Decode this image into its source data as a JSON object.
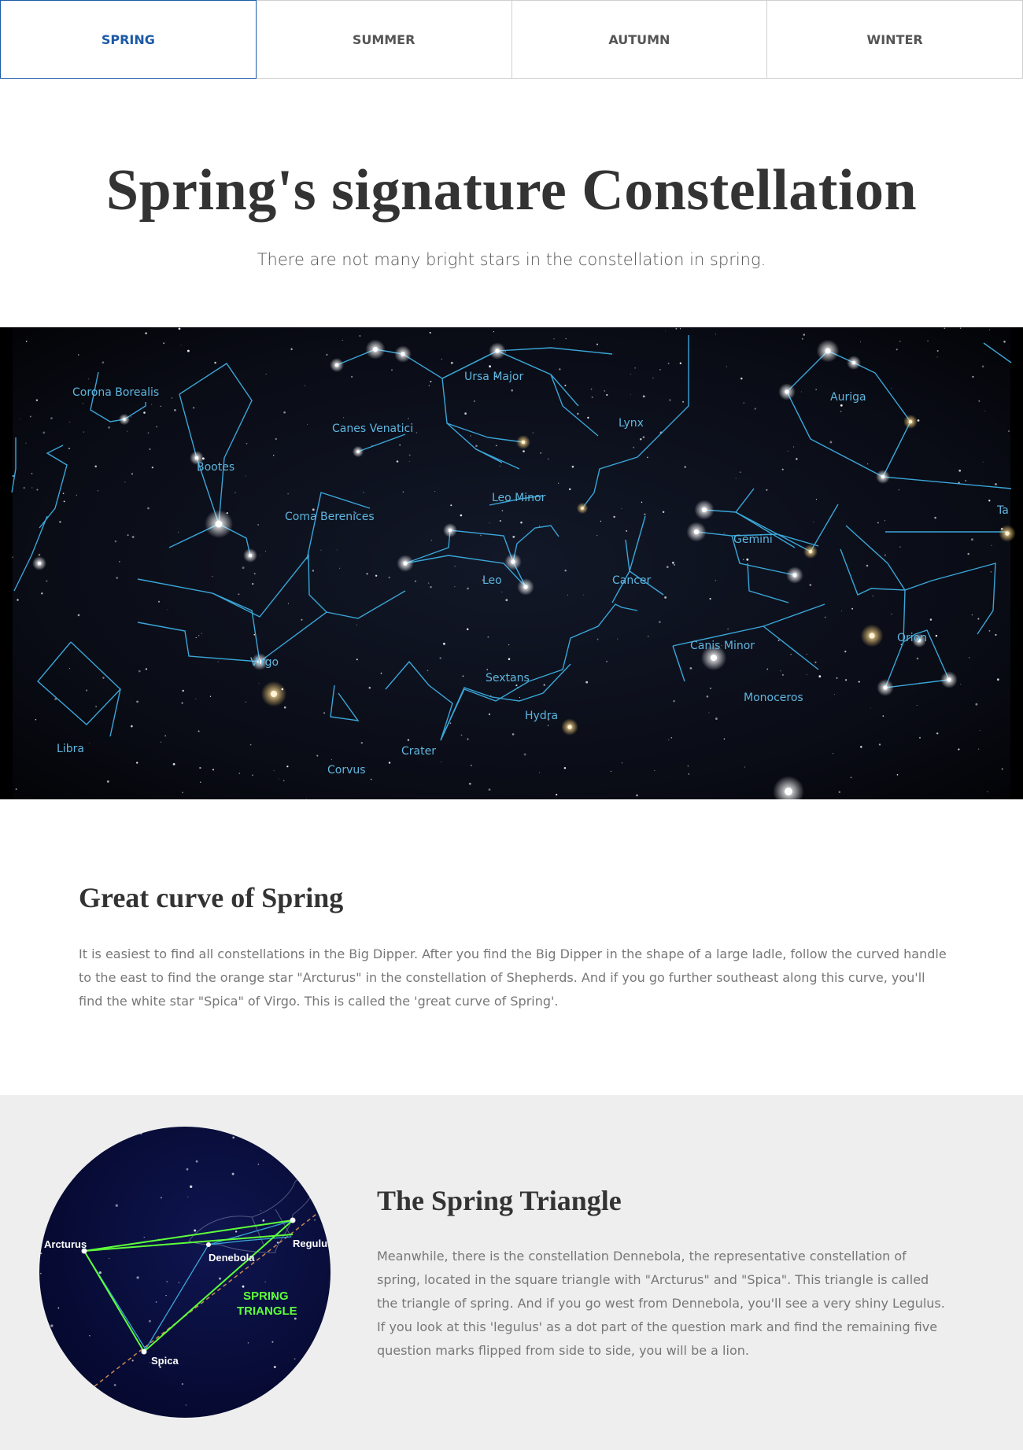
{
  "tabs": [
    {
      "label": "SPRING",
      "active": true
    },
    {
      "label": "SUMMER",
      "active": false
    },
    {
      "label": "AUTUMN",
      "active": false
    },
    {
      "label": "WINTER",
      "active": false
    }
  ],
  "hero": {
    "title": "Spring's signature Constellation",
    "subtitle": "There are not many bright stars in the constellation in spring."
  },
  "starmap": {
    "labels": [
      "Corona Borealis",
      "Ursa Major",
      "Auriga",
      "Canes Venatici",
      "Lynx",
      "Bootes",
      "Leo Minor",
      "Coma Berenices",
      "Gemini",
      "Ta",
      "Leo",
      "Cancer",
      "Canis Minor",
      "Orion",
      "Virgo",
      "Sextans",
      "Monoceros",
      "Hydra",
      "Libra",
      "Crater",
      "Corvus"
    ],
    "line_color": "#3aa6d8"
  },
  "section1": {
    "title": "Great curve of Spring",
    "body": "It is easiest to find all constellations in the Big Dipper. After you find the Big Dipper in the shape of a large ladle, follow the curved handle to the east to find the orange star \"Arcturus\" in the constellation of Shepherds. And if you go further southeast along this curve, you'll find the white star \"Spica\" of Virgo. This is called the 'great curve of Spring'."
  },
  "section2": {
    "title": "The Spring Triangle",
    "body": "Meanwhile, there is the constellation Dennebola, the representative constellation of spring, located in the square triangle with \"Arcturus\" and \"Spica\". This triangle is called the triangle of spring. And if you go west from Dennebola, you'll see a very shiny Legulus. If you look at this 'legulus' as a dot part of the question mark and find the remaining five question marks flipped from side to side, you will be a lion.",
    "diagram": {
      "stars": [
        "Arcturus",
        "Denebola",
        "Regulus",
        "Spica"
      ],
      "name_line1": "SPRING",
      "name_line2": "TRIANGLE",
      "triangle_color": "#5dff3a"
    }
  }
}
